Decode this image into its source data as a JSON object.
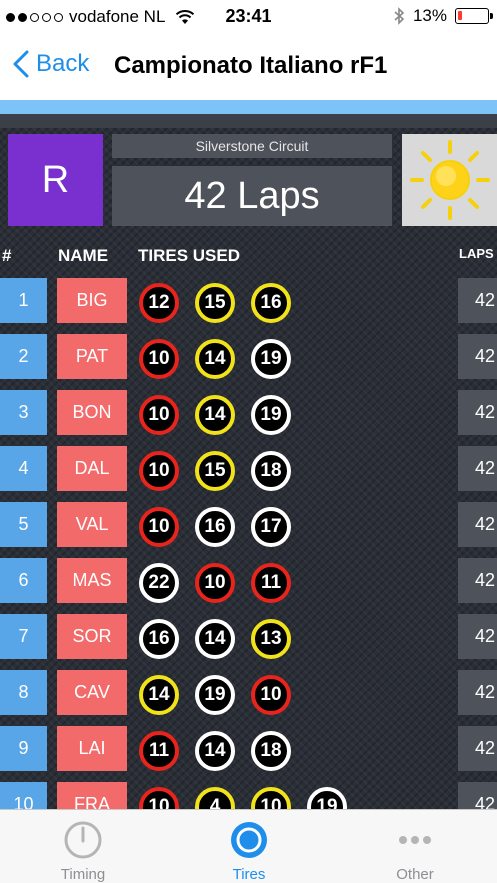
{
  "status_bar": {
    "carrier": "vodafone NL",
    "time": "23:41",
    "battery_percent_label": "13%",
    "battery_level": 0.13,
    "signal_bars_filled": 2,
    "signal_bars_total": 5
  },
  "nav": {
    "back_label": "Back",
    "title": "Campionato Italiano rF1"
  },
  "race": {
    "round_label": "R",
    "circuit": "Silverstone Circuit",
    "laps_label": "42 Laps",
    "weather_icon": "sun-icon"
  },
  "table": {
    "headers": {
      "position": "#",
      "name": "NAME",
      "tires": "TIRES USED",
      "laps": "LAPS"
    },
    "rows": [
      {
        "pos": "1",
        "name": "BIG",
        "tires": [
          {
            "n": "12",
            "c": "red"
          },
          {
            "n": "15",
            "c": "yellow"
          },
          {
            "n": "16",
            "c": "yellow"
          }
        ],
        "laps": "42"
      },
      {
        "pos": "2",
        "name": "PAT",
        "tires": [
          {
            "n": "10",
            "c": "red"
          },
          {
            "n": "14",
            "c": "yellow"
          },
          {
            "n": "19",
            "c": "white"
          }
        ],
        "laps": "42"
      },
      {
        "pos": "3",
        "name": "BON",
        "tires": [
          {
            "n": "10",
            "c": "red"
          },
          {
            "n": "14",
            "c": "yellow"
          },
          {
            "n": "19",
            "c": "white"
          }
        ],
        "laps": "42"
      },
      {
        "pos": "4",
        "name": "DAL",
        "tires": [
          {
            "n": "10",
            "c": "red"
          },
          {
            "n": "15",
            "c": "yellow"
          },
          {
            "n": "18",
            "c": "white"
          }
        ],
        "laps": "42"
      },
      {
        "pos": "5",
        "name": "VAL",
        "tires": [
          {
            "n": "10",
            "c": "red"
          },
          {
            "n": "16",
            "c": "white"
          },
          {
            "n": "17",
            "c": "white"
          }
        ],
        "laps": "42"
      },
      {
        "pos": "6",
        "name": "MAS",
        "tires": [
          {
            "n": "22",
            "c": "white"
          },
          {
            "n": "10",
            "c": "red"
          },
          {
            "n": "11",
            "c": "red"
          }
        ],
        "laps": "42"
      },
      {
        "pos": "7",
        "name": "SOR",
        "tires": [
          {
            "n": "16",
            "c": "white"
          },
          {
            "n": "14",
            "c": "white"
          },
          {
            "n": "13",
            "c": "yellow"
          }
        ],
        "laps": "42"
      },
      {
        "pos": "8",
        "name": "CAV",
        "tires": [
          {
            "n": "14",
            "c": "yellow"
          },
          {
            "n": "19",
            "c": "white"
          },
          {
            "n": "10",
            "c": "red"
          }
        ],
        "laps": "42"
      },
      {
        "pos": "9",
        "name": "LAI",
        "tires": [
          {
            "n": "11",
            "c": "red"
          },
          {
            "n": "14",
            "c": "white"
          },
          {
            "n": "18",
            "c": "white"
          }
        ],
        "laps": "42"
      },
      {
        "pos": "10",
        "name": "FRA",
        "tires": [
          {
            "n": "10",
            "c": "red"
          },
          {
            "n": "4",
            "c": "yellow"
          },
          {
            "n": "10",
            "c": "yellow"
          },
          {
            "n": "19",
            "c": "white"
          }
        ],
        "laps": "42"
      }
    ]
  },
  "tabs": [
    {
      "label": "Timing",
      "icon": "stopwatch-icon",
      "active": false
    },
    {
      "label": "Tires",
      "icon": "tire-icon",
      "active": true
    },
    {
      "label": "Other",
      "icon": "more-dots-icon",
      "active": false
    }
  ],
  "colors": {
    "accent": "#1e8eea",
    "round_badge": "#7a2fcf",
    "position_cell": "#58a6e8",
    "name_cell": "#f26a6a",
    "tire_red": "#e8241c",
    "tire_yellow": "#f1e21a",
    "tire_white": "#ffffff"
  }
}
